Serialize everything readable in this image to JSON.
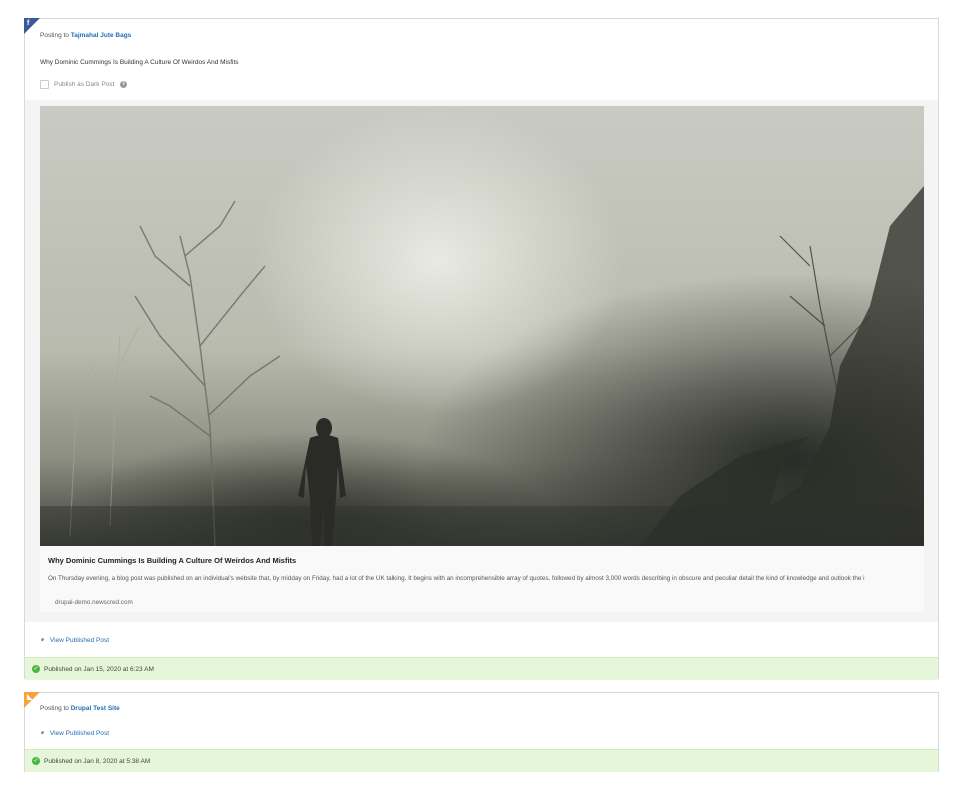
{
  "posts": [
    {
      "network_icon": "facebook-icon",
      "network_color": "#3b5998",
      "posting_prefix": "Posting to",
      "target": "Tajmahal Jute Bags",
      "message": "Why Dominic Cummings Is Building A Culture Of Weirdos And Misfits",
      "dark_post_label": "Publish as Dark Post",
      "preview": {
        "title": "Why Dominic Cummings Is Building A Culture Of Weirdos And Misfits",
        "description": "On Thursday evening, a blog post was published on an individual's website that, by midday on Friday, had a lot of the UK talking. It begins with an incomprehensible array of quotes, followed by almost 3,000 words describing in obscure and peculiar detail the kind of knowledge and outlook the i",
        "domain": "drupal-demo.newscred.com"
      },
      "view_link": "View Published Post",
      "status": "Published on Jan 15, 2020 at 6:23 AM"
    },
    {
      "network_icon": "rss-icon",
      "network_color": "#f7a23b",
      "posting_prefix": "Posting to",
      "target": "Drupal Test Site",
      "view_link": "View Published Post",
      "status": "Published on Jan 8, 2020 at 5:38 AM"
    }
  ]
}
